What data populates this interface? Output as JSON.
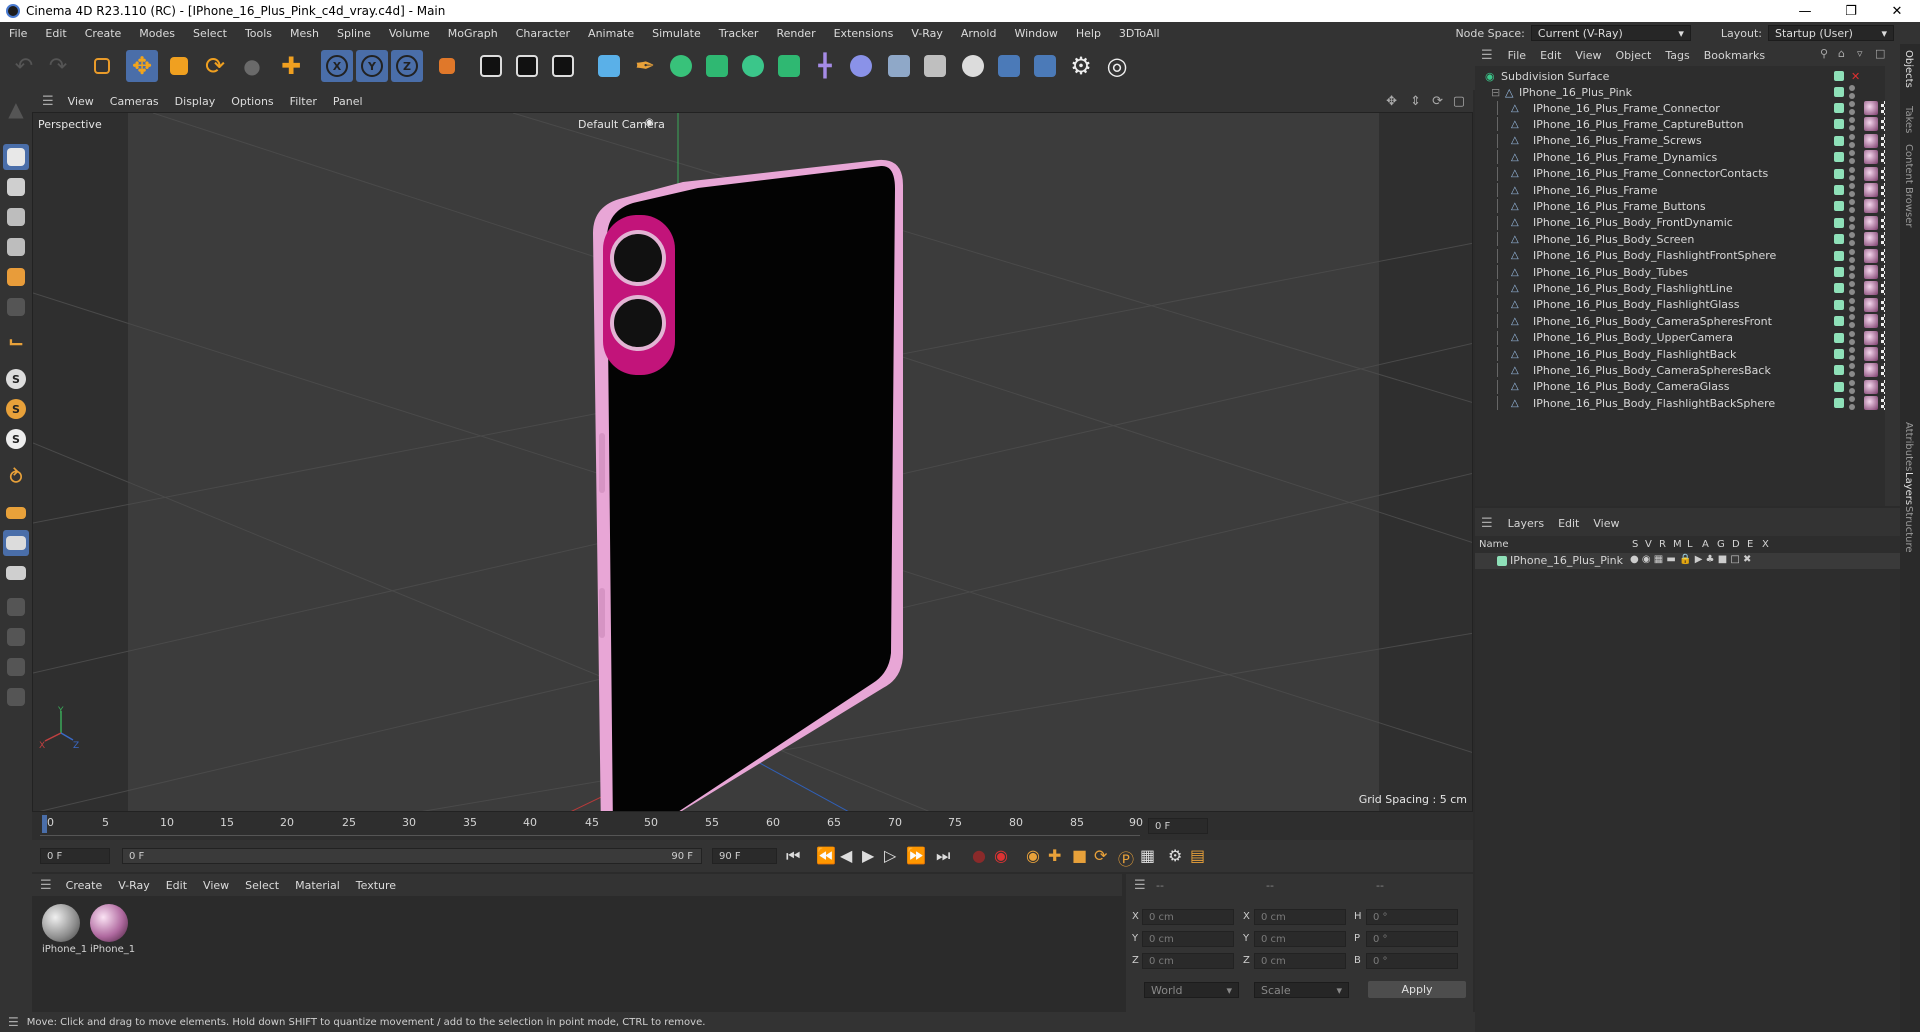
{
  "window": {
    "title": "Cinema 4D R23.110 (RC) - [IPhone_16_Plus_Pink_c4d_vray.c4d] - Main",
    "minimize": "—",
    "maximize": "❐",
    "close": "✕"
  },
  "menubar": {
    "items": [
      "File",
      "Edit",
      "Create",
      "Modes",
      "Select",
      "Tools",
      "Mesh",
      "Spline",
      "Volume",
      "MoGraph",
      "Character",
      "Animate",
      "Simulate",
      "Tracker",
      "Render",
      "Extensions",
      "V-Ray",
      "Arnold",
      "Window",
      "Help",
      "3DToAll"
    ],
    "node_space_label": "Node Space:",
    "node_space_value": "Current (V-Ray)",
    "layout_label": "Layout:",
    "layout_value": "Startup (User)"
  },
  "viewport": {
    "menu": [
      "View",
      "Cameras",
      "Display",
      "Options",
      "Filter",
      "Panel"
    ],
    "label": "Perspective",
    "camera": "Default Camera",
    "grid_spacing": "Grid Spacing : 5 cm",
    "axis_x": "X",
    "axis_y": "Y",
    "axis_z": "Z"
  },
  "timeline": {
    "ticks": [
      "0",
      "5",
      "10",
      "15",
      "20",
      "25",
      "30",
      "35",
      "40",
      "45",
      "50",
      "55",
      "60",
      "65",
      "70",
      "75",
      "80",
      "85",
      "90"
    ],
    "current_frame": "0 F",
    "start_field": "0 F",
    "range_start": "0 F",
    "range_end": "90 F",
    "end_field": "90 F"
  },
  "materials": {
    "menu": [
      "Create",
      "V-Ray",
      "Edit",
      "View",
      "Select",
      "Material",
      "Texture"
    ],
    "items": [
      {
        "label": "iPhone_1"
      },
      {
        "label": "iPhone_1"
      }
    ]
  },
  "coordinates": {
    "header": [
      "--",
      "--",
      "--"
    ],
    "rows": [
      {
        "pos_label": "X",
        "pos": "0 cm",
        "size_label": "X",
        "size": "0 cm",
        "rot_label": "H",
        "rot": "0 °"
      },
      {
        "pos_label": "Y",
        "pos": "0 cm",
        "size_label": "Y",
        "size": "0 cm",
        "rot_label": "P",
        "rot": "0 °"
      },
      {
        "pos_label": "Z",
        "pos": "0 cm",
        "size_label": "Z",
        "size": "0 cm",
        "rot_label": "B",
        "rot": "0 °"
      }
    ],
    "mode": "World",
    "scale": "Scale",
    "apply": "Apply"
  },
  "status": "Move: Click and drag to move elements. Hold down SHIFT to quantize movement / add to the selection in point mode, CTRL to remove.",
  "objects": {
    "menu": [
      "File",
      "Edit",
      "View",
      "Object",
      "Tags",
      "Bookmarks"
    ],
    "root": "Subdivision Surface",
    "group": "IPhone_16_Plus_Pink",
    "children": [
      "IPhone_16_Plus_Frame_Connector",
      "IPhone_16_Plus_Frame_CaptureButton",
      "IPhone_16_Plus_Frame_Screws",
      "IPhone_16_Plus_Frame_Dynamics",
      "IPhone_16_Plus_Frame_ConnectorContacts",
      "IPhone_16_Plus_Frame",
      "IPhone_16_Plus_Frame_Buttons",
      "IPhone_16_Plus_Body_FrontDynamic",
      "IPhone_16_Plus_Body_Screen",
      "IPhone_16_Plus_Body_FlashlightFrontSphere",
      "IPhone_16_Plus_Body_Tubes",
      "IPhone_16_Plus_Body_FlashlightLine",
      "IPhone_16_Plus_Body_FlashlightGlass",
      "IPhone_16_Plus_Body_CameraSpheresFront",
      "IPhone_16_Plus_Body_UpperCamera",
      "IPhone_16_Plus_Body_FlashlightBack",
      "IPhone_16_Plus_Body_CameraSpheresBack",
      "IPhone_16_Plus_Body_CameraGlass",
      "IPhone_16_Plus_Body_FlashlightBackSphere"
    ]
  },
  "layers": {
    "menu": [
      "Layers",
      "Edit",
      "View"
    ],
    "name_col": "Name",
    "flags": [
      "S",
      "V",
      "R",
      "M",
      "L",
      "A",
      "G",
      "D",
      "E",
      "X"
    ],
    "rows": [
      "IPhone_16_Plus_Pink"
    ]
  },
  "right_tabs": [
    "Objects",
    "Takes",
    "Content Browser",
    "Attributes",
    "Layers",
    "Structure"
  ],
  "colors": {
    "accent": "#4a6ea9",
    "phone_frame": "#e8a6d6",
    "camera_bump": "#c2147a",
    "layer_color": "#8ee0b8"
  }
}
